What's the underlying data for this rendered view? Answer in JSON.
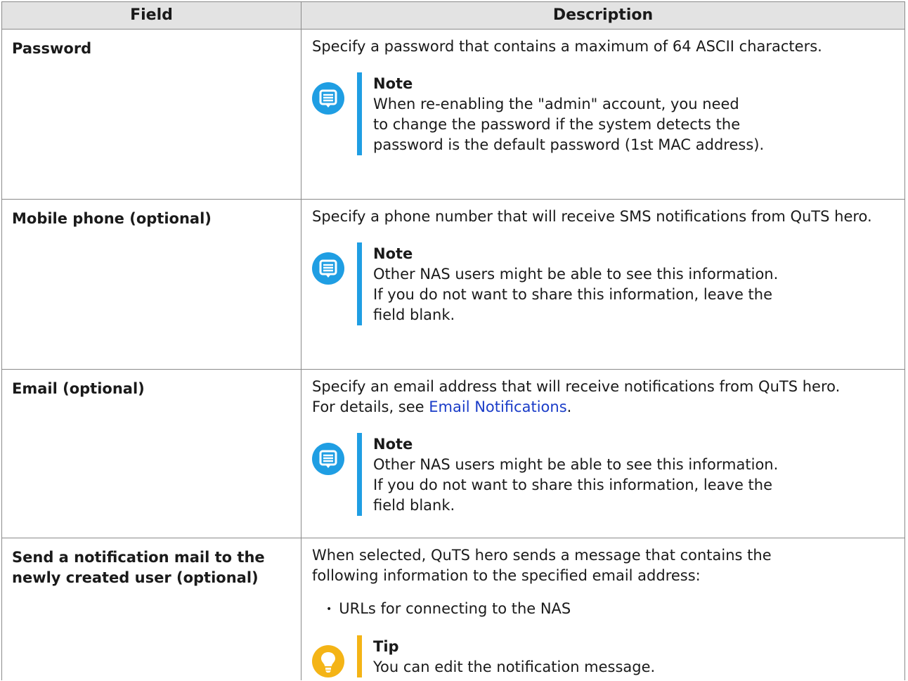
{
  "table": {
    "header": {
      "field": "Field",
      "description": "Description"
    },
    "rows": [
      {
        "field": "Password",
        "description": "Specify a password that contains a maximum of 64 ASCII characters.",
        "note": {
          "title": "Note",
          "lines": [
            "When re-enabling the \"admin\" account, you need",
            "to change the password if the system detects the",
            "password is the default password (1st MAC address)."
          ]
        }
      },
      {
        "field": "Mobile phone (optional)",
        "description": "Specify a phone number that will receive SMS notifications from QuTS hero.",
        "note": {
          "title": "Note",
          "lines": [
            "Other NAS users might be able to see this information.",
            "If you do not want to share this information, leave the",
            "field blank."
          ]
        }
      },
      {
        "field": "Email (optional)",
        "description": "Specify an email address that will receive notifications from QuTS hero.",
        "details_prefix": "For details, see ",
        "details_link": "Email Notifications",
        "details_suffix": ".",
        "note": {
          "title": "Note",
          "lines": [
            "Other NAS users might be able to see this information.",
            "If you do not want to share this information, leave the",
            "field blank."
          ]
        }
      },
      {
        "field_lines": [
          "Send a notification mail to the",
          "newly created user (optional)"
        ],
        "description_lines": [
          "When selected, QuTS hero sends a message that contains the",
          "following information to the specified email address:"
        ],
        "bullets": [
          "URLs for connecting to the NAS"
        ],
        "tip": {
          "title": "Tip",
          "text": "You can edit the notification message."
        }
      }
    ]
  },
  "colors": {
    "note_accent": "#1f9ee3",
    "tip_accent": "#f4b416",
    "link": "#1a3cc8",
    "header_bg": "#e3e3e3"
  },
  "icons": {
    "note": "note-icon",
    "tip": "lightbulb-icon"
  }
}
